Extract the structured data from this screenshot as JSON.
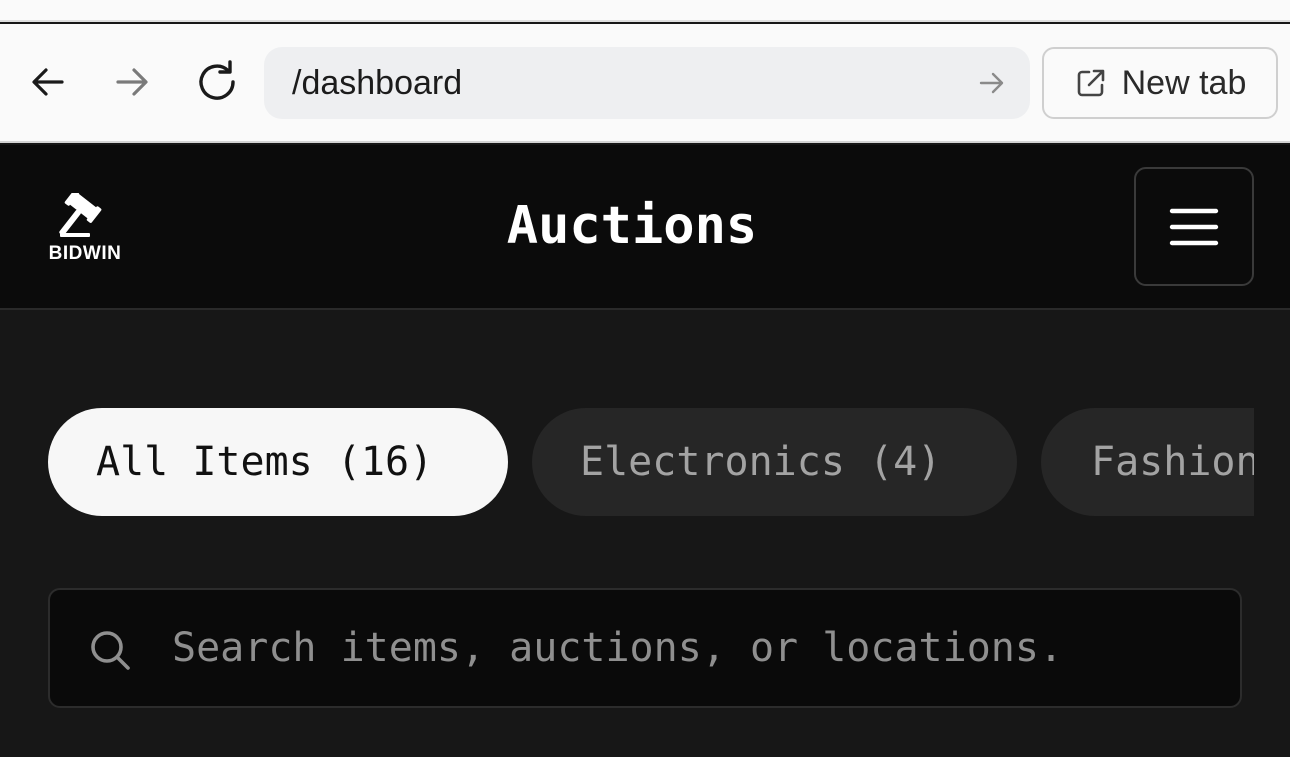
{
  "browser": {
    "url": "/dashboard",
    "new_tab_label": "New tab",
    "icons": {
      "back": "arrow-left-icon",
      "forward": "arrow-right-icon",
      "reload": "reload-icon",
      "go": "arrow-right-icon",
      "new_tab": "external-link-icon"
    }
  },
  "header": {
    "logo_text": "BIDWIN",
    "logo_icon": "gavel-icon",
    "title": "Auctions",
    "menu_icon": "hamburger-menu-icon"
  },
  "categories": [
    {
      "label": "All Items (16)",
      "active": true
    },
    {
      "label": "Electronics (4)",
      "active": false
    },
    {
      "label": "Fashion",
      "active": false
    }
  ],
  "search": {
    "placeholder": "Search items, auctions, or locations.",
    "value": "",
    "icon": "search-icon"
  },
  "colors": {
    "page_background": "#171717",
    "header_background": "#0b0b0b",
    "pill_active": "#f7f7f7",
    "pill_inactive": "#262626",
    "browser_chrome": "#fafafa"
  }
}
